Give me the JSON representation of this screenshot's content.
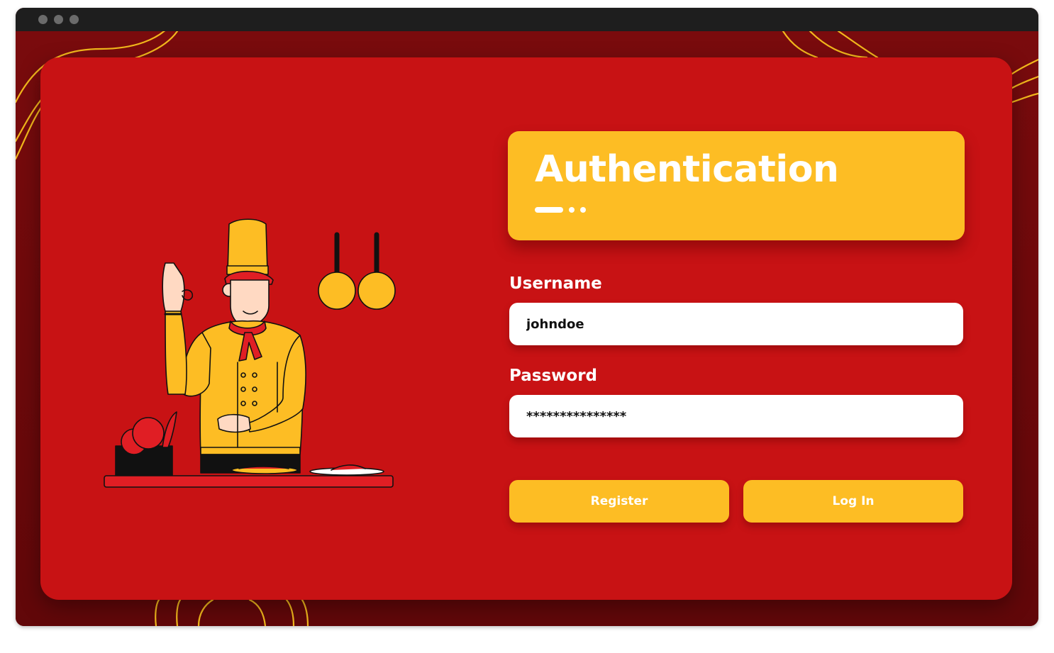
{
  "window": {
    "controls": [
      "window-dot",
      "window-dot",
      "window-dot"
    ]
  },
  "auth": {
    "title": "Authentication"
  },
  "form": {
    "username_label": "Username",
    "username_value": "johndoe",
    "password_label": "Password",
    "password_value": "***************",
    "register_label": "Register",
    "login_label": "Log In"
  },
  "illustration": {
    "icon": "chef-illustration"
  },
  "colors": {
    "background": "#6e0a0c",
    "card": "#c81214",
    "accent": "#fdbd24",
    "text": "#ffffff"
  }
}
